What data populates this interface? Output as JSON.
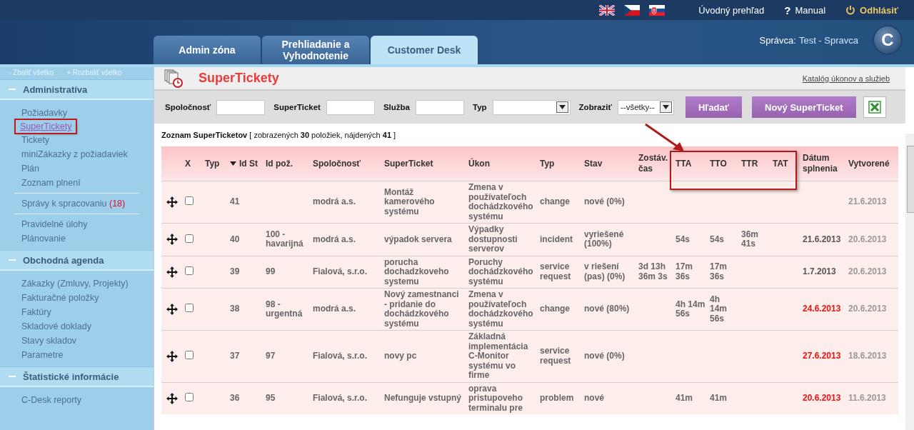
{
  "header": {
    "languages": [
      {
        "kind": "uk"
      },
      {
        "kind": "cz"
      },
      {
        "kind": "sk"
      }
    ],
    "links": [
      {
        "kind": "home",
        "label": "Úvodný prehľad"
      },
      {
        "kind": "help",
        "icon": "?",
        "label": "Manual"
      },
      {
        "kind": "logout",
        "label": "Odhlásiť"
      }
    ],
    "tabs": [
      {
        "label": "Admin zóna",
        "selected": false
      },
      {
        "label": "Prehliadanie a Vyhodnotenie",
        "selected": false
      },
      {
        "label": "Customer Desk",
        "selected": true
      }
    ],
    "user_label": "Správca:",
    "user_name": "Test - Spravca",
    "logo_text": "C"
  },
  "sidebar": {
    "collapse_all": "Zbaliť všetko",
    "expand_all": "Rozbaliť všetko",
    "collapse_icon": "-",
    "expand_icon": "+",
    "sections": [
      {
        "title": "Administratíva",
        "expanded": true,
        "groups": [
          [
            {
              "label": "Požiadavky",
              "selected": false
            },
            {
              "label": "SuperTickety",
              "selected": true
            },
            {
              "label": "Tickety",
              "selected": false
            },
            {
              "label": "miniZákazky z požiadaviek",
              "selected": false
            },
            {
              "label": "Plán",
              "selected": false
            },
            {
              "label": "Zoznam plnení",
              "selected": false
            }
          ],
          [
            {
              "label": "Správy k spracovaniu",
              "count": "(18)",
              "selected": false
            }
          ],
          [
            {
              "label": "Pravidelné úlohy",
              "selected": false
            },
            {
              "label": "Plánovanie",
              "selected": false
            }
          ]
        ]
      },
      {
        "title": "Obchodná agenda",
        "expanded": true,
        "groups": [
          [
            {
              "label": "Zákazky (Zmluvy, Projekty)",
              "selected": false
            },
            {
              "label": "Fakturačné položky",
              "selected": false
            },
            {
              "label": "Faktúry",
              "selected": false
            },
            {
              "label": "Skladové doklady",
              "selected": false
            },
            {
              "label": "Stavy skladov",
              "selected": false
            },
            {
              "label": "Parametre",
              "selected": false
            }
          ]
        ]
      },
      {
        "title": "Štatistické informácie",
        "expanded": true,
        "groups": [
          [
            {
              "label": "C-Desk reporty",
              "selected": false
            }
          ]
        ]
      }
    ]
  },
  "page": {
    "title": "SuperTickety",
    "catalog_link": "Katalóg úkonov a služieb"
  },
  "filters": [
    {
      "label": "Spoločnosť",
      "kind": "text"
    },
    {
      "label": "SuperTicket",
      "kind": "text"
    },
    {
      "label": "Služba",
      "kind": "text"
    },
    {
      "label": "Typ",
      "kind": "select"
    },
    {
      "label": "Zobraziť",
      "kind": "select",
      "value": "--všetky--"
    }
  ],
  "buttons": [
    {
      "label": "Hľadať",
      "kind": "primary"
    },
    {
      "label": "Nový SuperTicket",
      "kind": "primary"
    },
    {
      "kind": "excel"
    }
  ],
  "list_title": "**Zoznam SuperTicketov** [ zobrazených **30** položiek, nájdených **41** ]",
  "table": {
    "columns": [
      {
        "label": "X",
        "sorted": false
      },
      {
        "label": "Typ",
        "sorted": false
      },
      {
        "label": "Id St",
        "sorted": true
      },
      {
        "label": "Id pož.",
        "sorted": false
      },
      {
        "label": "Spoločnosť",
        "sorted": false
      },
      {
        "label": "SuperTicket",
        "sorted": false
      },
      {
        "label": "Úkon",
        "sorted": false
      },
      {
        "label": "Typ",
        "sorted": false
      },
      {
        "label": "Stav",
        "sorted": false
      },
      {
        "label": "Zostáv. čas",
        "sorted": false
      },
      {
        "label": "TTA",
        "sorted": false
      },
      {
        "label": "TTO",
        "sorted": false
      },
      {
        "label": "TTR",
        "sorted": false
      },
      {
        "label": "TAT",
        "sorted": false
      },
      {
        "label": "Dátum splnenia",
        "sorted": false
      },
      {
        "label": "Vytvorené",
        "sorted": false
      }
    ],
    "rows": [
      {
        "checked": false,
        "id_st": "41",
        "company": "modrá a.s.",
        "superticket": "Montáž kamerového systému",
        "action": "Zmena v používateľoch dochádzkového systému",
        "type": "change",
        "status": "nové (0%)",
        "created": "21.6.2013"
      },
      {
        "checked": false,
        "id_st": "40",
        "id_poz": "100 - havarijná",
        "company": "modrá a.s.",
        "superticket": "výpadok servera",
        "action": "Výpadky dostupnosti serverov",
        "type": "incident",
        "status": "vyriešené (100%)",
        "tta": "54s",
        "tto": "54s",
        "ttr": "36m 41s",
        "due_date": "21.6.2013",
        "overdue": false,
        "created": "20.6.2013"
      },
      {
        "checked": false,
        "id_st": "39",
        "id_poz": "99",
        "company": "Fialová, s.r.o.",
        "superticket": "porucha dochadzkoveho systemu",
        "action": "Poruchy dochádzkového systému",
        "type": "service request",
        "status": "v riešení (pas) (0%)",
        "remaining": "3d 13h 36m 3s",
        "tta": "17m 36s",
        "tto": "17m 36s",
        "due_date": "1.7.2013",
        "overdue": false,
        "created": "20.6.2013"
      },
      {
        "checked": false,
        "id_st": "38",
        "id_poz": "98 - urgentná",
        "company": "modrá a.s.",
        "superticket": "Nový zamestnanci - pridanie do dochádzkového systému",
        "action": "Zmena v používateľoch dochádzkového systému",
        "type": "change",
        "status": "nové (80%)",
        "tta": "4h 14m 56s",
        "tto": "4h 14m 56s",
        "due_date": "24.6.2013",
        "overdue": true,
        "created": "20.6.2013"
      },
      {
        "checked": false,
        "id_st": "37",
        "id_poz": "97",
        "company": "Fialová, s.r.o.",
        "superticket": "novy pc",
        "action": "Základná implementácia C-Monitor systému vo firme",
        "type": "service request",
        "status": "nové (0%)",
        "due_date": "27.6.2013",
        "overdue": true,
        "created": "18.6.2013"
      },
      {
        "checked": false,
        "id_st": "36",
        "id_poz": "95",
        "company": "Fialová, s.r.o.",
        "superticket": "Nefunguje vstupný",
        "action": "oprava pristupoveho terminalu pre",
        "type": "problem",
        "status": "nové",
        "tta": "41m",
        "tto": "41m",
        "due_date": "20.6.2013",
        "overdue": true,
        "created": "11.6.2013"
      }
    ]
  }
}
